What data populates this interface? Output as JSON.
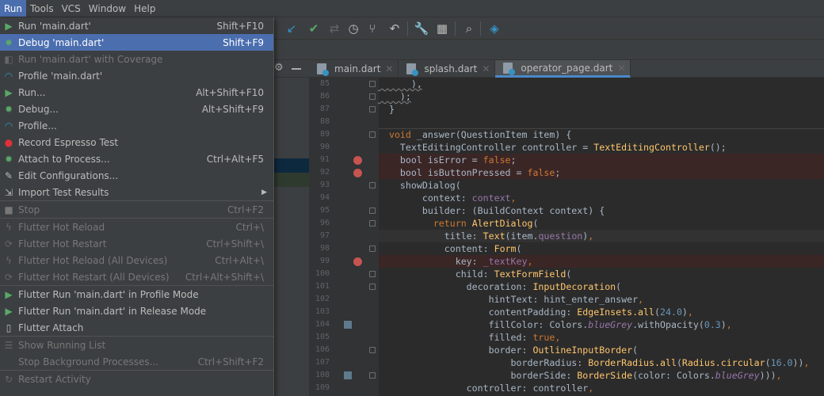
{
  "menubar": {
    "items": [
      "Run",
      "Tools",
      "VCS",
      "Window",
      "Help"
    ],
    "active": "Run"
  },
  "run_menu": {
    "groups": [
      [
        {
          "label": "Run 'main.dart'",
          "shortcut": "Shift+F10",
          "icon": "run-icon",
          "state": "normal"
        },
        {
          "label": "Debug 'main.dart'",
          "shortcut": "Shift+F9",
          "icon": "debug-icon",
          "state": "selected"
        },
        {
          "label": "Run 'main.dart' with Coverage",
          "shortcut": "",
          "icon": "coverage-icon",
          "state": "disabled"
        },
        {
          "label": "Profile 'main.dart'",
          "shortcut": "",
          "icon": "profile-icon",
          "state": "normal"
        },
        {
          "label": "Run...",
          "shortcut": "Alt+Shift+F10",
          "icon": "run-icon",
          "state": "normal"
        },
        {
          "label": "Debug...",
          "shortcut": "Alt+Shift+F9",
          "icon": "debug-icon",
          "state": "normal"
        },
        {
          "label": "Profile...",
          "shortcut": "",
          "icon": "profile-icon",
          "state": "normal"
        },
        {
          "label": "Record Espresso Test",
          "shortcut": "",
          "icon": "record-icon",
          "state": "normal"
        },
        {
          "label": "Attach to Process...",
          "shortcut": "Ctrl+Alt+F5",
          "icon": "attach-icon",
          "state": "normal"
        },
        {
          "label": "Edit Configurations...",
          "shortcut": "",
          "icon": "edit-icon",
          "state": "normal"
        },
        {
          "label": "Import Test Results",
          "shortcut": "",
          "icon": "import-icon",
          "state": "normal",
          "submenu": true
        }
      ],
      [
        {
          "label": "Stop",
          "shortcut": "Ctrl+F2",
          "icon": "stop-icon",
          "state": "disabled"
        }
      ],
      [
        {
          "label": "Flutter Hot Reload",
          "shortcut": "Ctrl+\\",
          "icon": "hot-reload-icon",
          "state": "disabled"
        },
        {
          "label": "Flutter Hot Restart",
          "shortcut": "Ctrl+Shift+\\",
          "icon": "hot-restart-icon",
          "state": "disabled"
        },
        {
          "label": "Flutter Hot Reload (All Devices)",
          "shortcut": "Ctrl+Alt+\\",
          "icon": "hot-reload-icon",
          "state": "disabled"
        },
        {
          "label": "Flutter Hot Restart (All Devices)",
          "shortcut": "Ctrl+Alt+Shift+\\",
          "icon": "hot-restart-icon",
          "state": "disabled"
        }
      ],
      [
        {
          "label": "Flutter Run 'main.dart' in Profile Mode",
          "shortcut": "",
          "icon": "run-icon",
          "state": "normal"
        },
        {
          "label": "Flutter Run 'main.dart' in Release Mode",
          "shortcut": "",
          "icon": "run-icon",
          "state": "normal"
        },
        {
          "label": "Flutter Attach",
          "shortcut": "",
          "icon": "flutter-attach-icon",
          "state": "normal"
        }
      ],
      [
        {
          "label": "Show Running List",
          "shortcut": "",
          "icon": "list-icon",
          "state": "disabled"
        },
        {
          "label": "Stop Background Processes...",
          "shortcut": "Ctrl+Shift+F2",
          "icon": "",
          "state": "disabled"
        }
      ],
      [
        {
          "label": "Restart Activity",
          "shortcut": "",
          "icon": "restart-activity-icon",
          "state": "disabled"
        }
      ]
    ]
  },
  "toolbar": {
    "icons": [
      "update-project-icon",
      "commit-icon",
      "compare-icon",
      "history-icon",
      "branch-icon",
      "revert-icon",
      "settings-wrench-icon",
      "project-structure-icon",
      "search-icon",
      "layers-icon"
    ]
  },
  "tabs": [
    {
      "label": "main.dart",
      "active": false
    },
    {
      "label": "splash.dart",
      "active": false
    },
    {
      "label": "operator_page.dart",
      "active": true
    }
  ],
  "editor": {
    "lines": [
      {
        "n": "85",
        "t": [
          [
            "      ),",
            "sq"
          ]
        ],
        "fold": true
      },
      {
        "n": "86",
        "t": [
          [
            "    );",
            "sq"
          ]
        ],
        "fold": true
      },
      {
        "n": "87",
        "t": [
          [
            "  }",
            ""
          ]
        ],
        "fold": true
      },
      {
        "n": "88",
        "t": []
      },
      {
        "n": "89",
        "t": [
          [
            "  ",
            ""
          ],
          [
            "void",
            "kw"
          ],
          [
            " _answer(QuestionItem item) {",
            ""
          ]
        ],
        "fold": true
      },
      {
        "n": "90",
        "t": [
          [
            "    TextEditingController controller = ",
            ""
          ],
          [
            "TextEditingController",
            "cls"
          ],
          [
            "();",
            ""
          ]
        ]
      },
      {
        "n": "91",
        "t": [
          [
            "    bool isError = ",
            ""
          ],
          [
            "false",
            "kw"
          ],
          [
            ";",
            ""
          ]
        ],
        "bp": true
      },
      {
        "n": "92",
        "t": [
          [
            "    bool isButtonPressed = ",
            ""
          ],
          [
            "false",
            "kw"
          ],
          [
            ";",
            ""
          ]
        ],
        "bp": true
      },
      {
        "n": "93",
        "t": [
          [
            "    showDialog(",
            ""
          ]
        ],
        "fold": true
      },
      {
        "n": "94",
        "t": [
          [
            "        context: ",
            ""
          ],
          [
            "context",
            "fld"
          ],
          [
            ",",
            "kw"
          ]
        ]
      },
      {
        "n": "95",
        "t": [
          [
            "        builder: (BuildContext context) {",
            ""
          ]
        ],
        "fold": true
      },
      {
        "n": "96",
        "t": [
          [
            "          ",
            ""
          ],
          [
            "return",
            "kw"
          ],
          [
            " ",
            ""
          ],
          [
            "AlertDialog",
            "cls"
          ],
          [
            "(",
            ""
          ]
        ],
        "fold": true
      },
      {
        "n": "97",
        "t": [
          [
            "            title: ",
            ""
          ],
          [
            "Text",
            "cls"
          ],
          [
            "(item.",
            ""
          ],
          [
            "question",
            "fld"
          ],
          [
            ")",
            ""
          ],
          [
            ",",
            "kw"
          ]
        ],
        "cur": true
      },
      {
        "n": "98",
        "t": [
          [
            "            content: ",
            ""
          ],
          [
            "Form",
            "cls"
          ],
          [
            "(",
            ""
          ]
        ],
        "fold": true
      },
      {
        "n": "99",
        "t": [
          [
            "              key: ",
            ""
          ],
          [
            "_textKey",
            "fld"
          ],
          [
            ",",
            "kw"
          ]
        ],
        "bp": true
      },
      {
        "n": "100",
        "t": [
          [
            "              child: ",
            ""
          ],
          [
            "TextFormField",
            "cls"
          ],
          [
            "(",
            ""
          ]
        ],
        "fold": true
      },
      {
        "n": "101",
        "t": [
          [
            "                decoration: ",
            ""
          ],
          [
            "InputDecoration",
            "cls"
          ],
          [
            "(",
            ""
          ]
        ],
        "fold": true
      },
      {
        "n": "102",
        "t": [
          [
            "                    hintText: hint_enter_answer",
            ""
          ],
          [
            ",",
            "kw"
          ]
        ]
      },
      {
        "n": "103",
        "t": [
          [
            "                    contentPadding: ",
            ""
          ],
          [
            "EdgeInsets.all",
            "cls"
          ],
          [
            "(",
            ""
          ],
          [
            "24.0",
            "num"
          ],
          [
            ")",
            ""
          ],
          [
            ",",
            "kw"
          ]
        ]
      },
      {
        "n": "104",
        "t": [
          [
            "                    fillColor: Colors.",
            ""
          ],
          [
            "blueGrey",
            "it"
          ],
          [
            ".withOpacity(",
            ""
          ],
          [
            "0.3",
            "num"
          ],
          [
            ")",
            ""
          ],
          [
            ",",
            "kw"
          ]
        ],
        "bm": true
      },
      {
        "n": "105",
        "t": [
          [
            "                    filled: ",
            ""
          ],
          [
            "true",
            "kw"
          ],
          [
            ",",
            "kw"
          ]
        ]
      },
      {
        "n": "106",
        "t": [
          [
            "                    border: ",
            ""
          ],
          [
            "OutlineInputBorder",
            "cls"
          ],
          [
            "(",
            ""
          ]
        ],
        "fold": true
      },
      {
        "n": "107",
        "t": [
          [
            "                        borderRadius: ",
            ""
          ],
          [
            "BorderRadius.all",
            "cls"
          ],
          [
            "(",
            ""
          ],
          [
            "Radius.circular",
            "cls"
          ],
          [
            "(",
            ""
          ],
          [
            "16.0",
            "num"
          ],
          [
            "))",
            ""
          ],
          [
            ",",
            "kw"
          ]
        ]
      },
      {
        "n": "108",
        "t": [
          [
            "                        borderSide: ",
            ""
          ],
          [
            "BorderSide",
            "cls"
          ],
          [
            "(color: Colors.",
            ""
          ],
          [
            "blueGrey",
            "it"
          ],
          [
            ")))",
            ""
          ],
          [
            ",",
            "kw"
          ]
        ],
        "bm": true,
        "fold": true
      },
      {
        "n": "109",
        "t": [
          [
            "                controller: controller",
            ""
          ],
          [
            ",",
            "kw"
          ]
        ]
      }
    ]
  },
  "colors": {
    "accent": "#4b6eaf",
    "breakpoint": "#c75450",
    "tab_underline": "#4a88c7"
  }
}
